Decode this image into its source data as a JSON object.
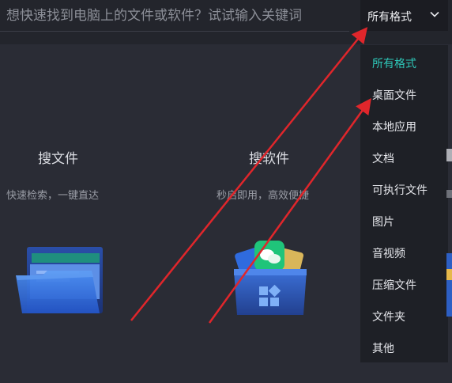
{
  "search": {
    "placeholder": "想快速找到电脑上的文件或软件？试试输入关键词",
    "value": ""
  },
  "format_select": {
    "selected": "所有格式"
  },
  "dropdown": {
    "items": [
      {
        "label": "所有格式",
        "active": true
      },
      {
        "label": "桌面文件"
      },
      {
        "label": "本地应用"
      },
      {
        "label": "文档"
      },
      {
        "label": "可执行文件"
      },
      {
        "label": "图片"
      },
      {
        "label": "音视频"
      },
      {
        "label": "压缩文件"
      },
      {
        "label": "文件夹"
      },
      {
        "label": "其他"
      }
    ]
  },
  "features": [
    {
      "title": "搜文件",
      "desc": "快速检索，一键直达",
      "icon": "folder-icon"
    },
    {
      "title": "搜软件",
      "desc": "秒启即用，高效便捷",
      "icon": "app-box-icon"
    }
  ],
  "colors": {
    "background": "#2a2c35",
    "topbar": "#23252c",
    "dropdown_bg": "#1e2026",
    "active_item": "#2ec7b8",
    "annotation_arrow": "#e0262b"
  }
}
